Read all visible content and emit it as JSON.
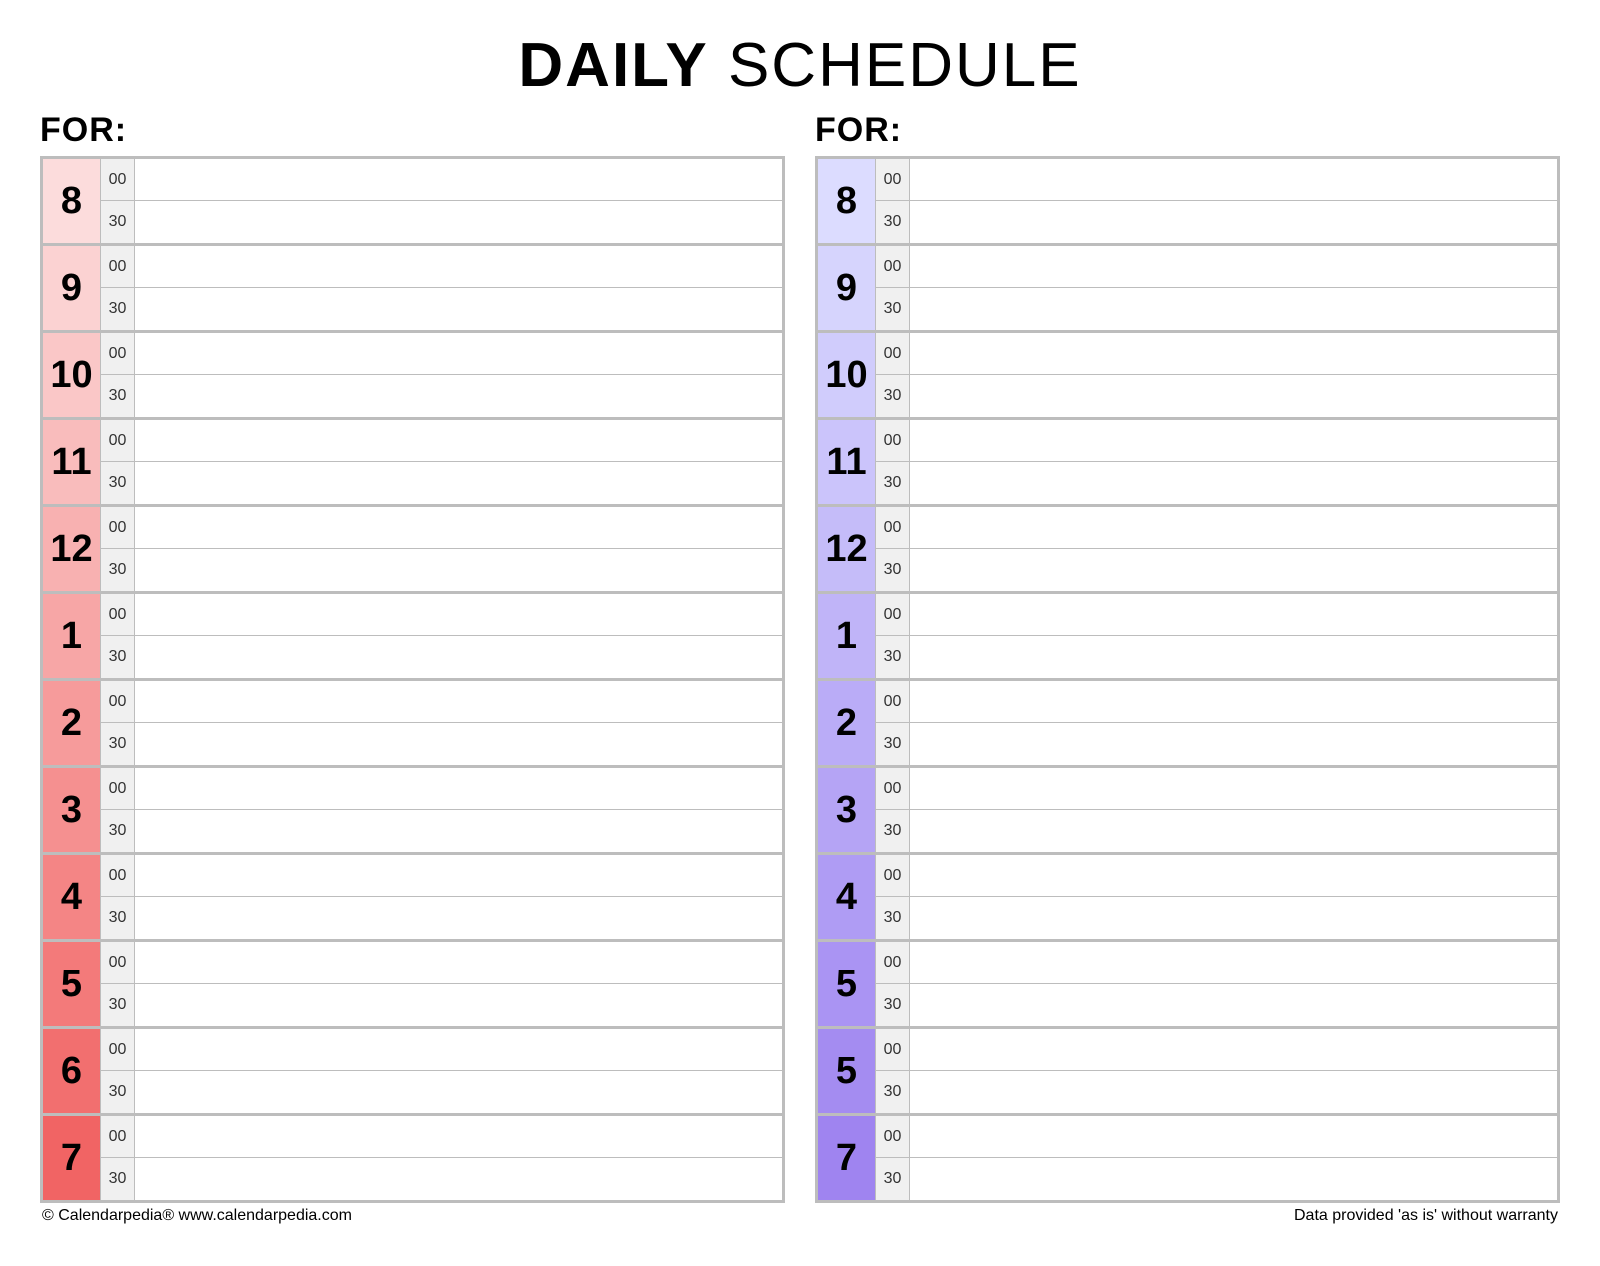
{
  "title_bold": "DAILY",
  "title_rest": " SCHEDULE",
  "for_label": "FOR:",
  "minute_labels": [
    "00",
    "30"
  ],
  "left": {
    "hours": [
      {
        "label": "8",
        "color": "#fcdcdc"
      },
      {
        "label": "9",
        "color": "#fbd2d2"
      },
      {
        "label": "10",
        "color": "#fac7c7"
      },
      {
        "label": "11",
        "color": "#f9bcbc"
      },
      {
        "label": "12",
        "color": "#f8b1b1"
      },
      {
        "label": "1",
        "color": "#f7a6a6"
      },
      {
        "label": "2",
        "color": "#f69b9b"
      },
      {
        "label": "3",
        "color": "#f59090"
      },
      {
        "label": "4",
        "color": "#f48585"
      },
      {
        "label": "5",
        "color": "#f37a7a"
      },
      {
        "label": "6",
        "color": "#f26f6f"
      },
      {
        "label": "7",
        "color": "#f16464"
      }
    ]
  },
  "right": {
    "hours": [
      {
        "label": "8",
        "color": "#dcdcff"
      },
      {
        "label": "9",
        "color": "#d6d4fd"
      },
      {
        "label": "10",
        "color": "#d0ccfc"
      },
      {
        "label": "11",
        "color": "#cbc4fb"
      },
      {
        "label": "12",
        "color": "#c5bcf9"
      },
      {
        "label": "1",
        "color": "#c0b4f8"
      },
      {
        "label": "2",
        "color": "#baacf7"
      },
      {
        "label": "3",
        "color": "#b5a4f5"
      },
      {
        "label": "4",
        "color": "#af9cf4"
      },
      {
        "label": "5",
        "color": "#aa94f3"
      },
      {
        "label": "5",
        "color": "#a48cf1"
      },
      {
        "label": "7",
        "color": "#9f84f0"
      }
    ]
  },
  "footer_left": "© Calendarpedia®   www.calendarpedia.com",
  "footer_right": "Data provided 'as is' without warranty"
}
